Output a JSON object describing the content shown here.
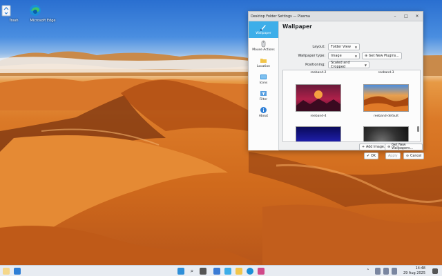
{
  "desktop": {
    "icons": [
      {
        "label": "Trash"
      },
      {
        "label": "Microsoft Edge"
      }
    ]
  },
  "window": {
    "title": "Desktop Folder Settings — Plasma",
    "controls": {
      "minimize": "–",
      "maximize": "□",
      "close": "✕"
    },
    "sidebar": [
      {
        "label": "Wallpaper"
      },
      {
        "label": "Mouse Actions"
      },
      {
        "label": "Location"
      },
      {
        "label": "Icons"
      },
      {
        "label": "Filter"
      },
      {
        "label": "About"
      }
    ],
    "page_title": "Wallpaper",
    "layout": {
      "label": "Layout:",
      "value": "Folder View"
    },
    "wallpaper_type": {
      "label": "Wallpaper type:",
      "value": "Image",
      "plugins_button": "Get New Plugins..."
    },
    "positioning": {
      "label": "Positioning:",
      "value": "Scaled and Cropped"
    },
    "gallery": {
      "top_labels": [
        "reeband-2",
        "reeband-3"
      ],
      "row_labels": [
        "reeband-4",
        "reeband-default"
      ]
    },
    "add_image": "Add Image...",
    "get_new_wallpapers": "Get New Wallpapers...",
    "ok": "OK",
    "apply": "Apply",
    "cancel": "Cancel"
  },
  "taskbar": {
    "time": "14:48",
    "date": "29 Aug 2025"
  },
  "colors": {
    "accent": "#3daee9",
    "window_bg": "#eff0f1"
  }
}
